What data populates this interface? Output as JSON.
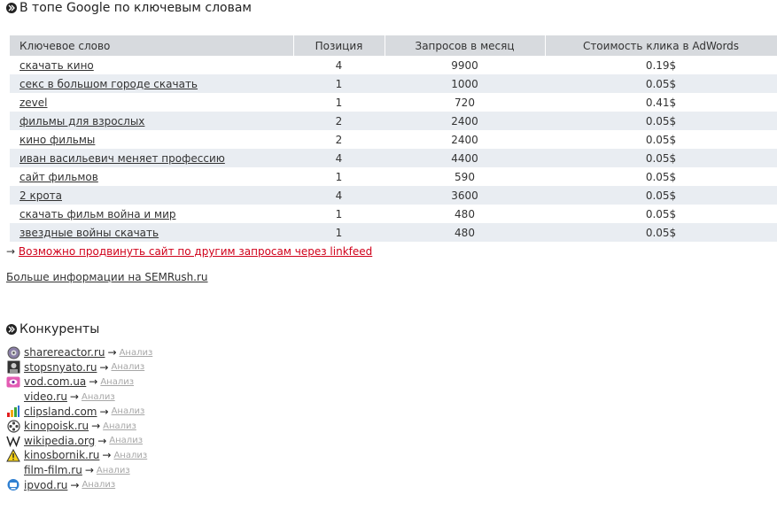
{
  "google_section": {
    "title": "В топе Google по ключевым словам",
    "columns": [
      "Ключевое слово",
      "Позиция",
      "Запросов в месяц",
      "Стоимость клика в AdWords"
    ],
    "rows": [
      {
        "keyword": "скачать кино",
        "position": "4",
        "queries": "9900",
        "cost": "0.19$"
      },
      {
        "keyword": "секс в большом городе скачать",
        "position": "1",
        "queries": "1000",
        "cost": "0.05$"
      },
      {
        "keyword": "zevel",
        "position": "1",
        "queries": "720",
        "cost": "0.41$"
      },
      {
        "keyword": "фильмы для взрослых",
        "position": "2",
        "queries": "2400",
        "cost": "0.05$"
      },
      {
        "keyword": "кино фильмы",
        "position": "2",
        "queries": "2400",
        "cost": "0.05$"
      },
      {
        "keyword": "иван васильевич меняет профессию",
        "position": "4",
        "queries": "4400",
        "cost": "0.05$"
      },
      {
        "keyword": "сайт фильмов",
        "position": "1",
        "queries": "590",
        "cost": "0.05$"
      },
      {
        "keyword": "2 крота",
        "position": "4",
        "queries": "3600",
        "cost": "0.05$"
      },
      {
        "keyword": "скачать фильм война и мир",
        "position": "1",
        "queries": "480",
        "cost": "0.05$"
      },
      {
        "keyword": "звездные войны скачать",
        "position": "1",
        "queries": "480",
        "cost": "0.05$"
      }
    ],
    "promo_arrow": "→",
    "promo_link": "Возможно продвинуть сайт по другим запросам через linkfeed",
    "more_link": "Больше информации на SEMRush.ru"
  },
  "competitors_section": {
    "title": "Конкуренты",
    "arrow": "→",
    "analysis_label": "Анализ",
    "items": [
      {
        "site": "sharereactor.ru",
        "icon": "sharereactor-favicon"
      },
      {
        "site": "stopsnyato.ru",
        "icon": "stopsnyato-favicon"
      },
      {
        "site": "vod.com.ua",
        "icon": "vod-favicon"
      },
      {
        "site": "video.ru",
        "icon": "none"
      },
      {
        "site": "clipsland.com",
        "icon": "clipsland-favicon"
      },
      {
        "site": "kinopoisk.ru",
        "icon": "film-reel-favicon"
      },
      {
        "site": "wikipedia.org",
        "icon": "wikipedia-favicon"
      },
      {
        "site": "kinosbornik.ru",
        "icon": "warning-favicon"
      },
      {
        "site": "film-film.ru",
        "icon": "none"
      },
      {
        "site": "ipvod.ru",
        "icon": "ipvod-favicon"
      }
    ]
  },
  "colors": {
    "header_bg": "#d7dade",
    "alt_row_bg": "#e9edf2",
    "promo_link": "#d0021b",
    "analysis_link": "#a7a7a7"
  }
}
